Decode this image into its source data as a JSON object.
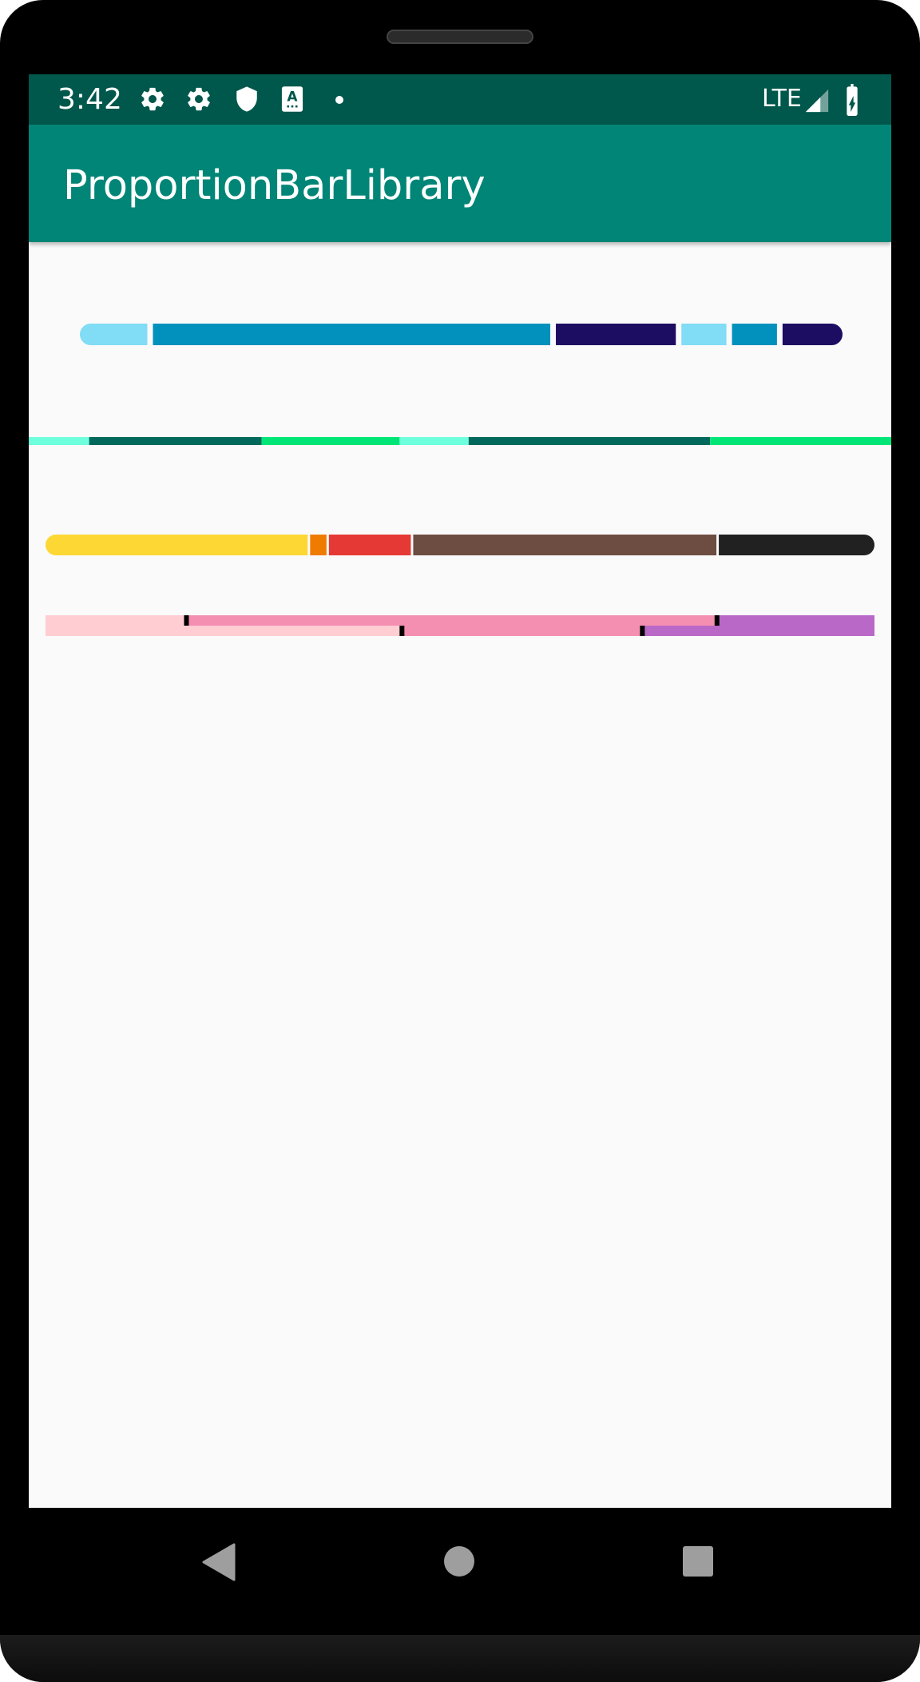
{
  "status_bar": {
    "time": "3:42",
    "network": "LTE",
    "icons": [
      "gear-icon",
      "gear-icon",
      "shield-icon",
      "text-a-icon",
      "dot-icon",
      "signal-icon",
      "battery-charging-icon"
    ]
  },
  "app_bar": {
    "title": "ProportionBarLibrary"
  },
  "colors": {
    "status_bar": "#00574b",
    "app_bar": "#008577",
    "background": "#fafafa"
  },
  "proportion_bars": [
    {
      "style": "rounded-ends, gaps between segments",
      "segments": [
        {
          "value": 0.09,
          "color": "#81dcf5"
        },
        {
          "value": 0.53,
          "color": "#0191bc"
        },
        {
          "value": 0.16,
          "color": "#1c0d62"
        },
        {
          "value": 0.06,
          "color": "#81dcf5"
        },
        {
          "value": 0.06,
          "color": "#0191bc"
        },
        {
          "value": 0.08,
          "color": "#1c0d62"
        }
      ]
    },
    {
      "style": "thin, full width, no gaps",
      "segments": [
        {
          "value": 0.07,
          "color": "#6effdd"
        },
        {
          "value": 0.2,
          "color": "#00695c"
        },
        {
          "value": 0.16,
          "color": "#00e676"
        },
        {
          "value": 0.08,
          "color": "#6effdd"
        },
        {
          "value": 0.28,
          "color": "#00695c"
        },
        {
          "value": 0.21,
          "color": "#00e676"
        }
      ]
    },
    {
      "style": "rounded-ends, thin separators",
      "segments": [
        {
          "value": 0.32,
          "color": "#fdd835"
        },
        {
          "value": 0.02,
          "color": "#ef7c00"
        },
        {
          "value": 0.1,
          "color": "#e53935"
        },
        {
          "value": 0.37,
          "color": "#6d4c41"
        },
        {
          "value": 0.19,
          "color": "#212121"
        }
      ]
    },
    {
      "style": "square ends, staggered halves with black dividers",
      "top_segments": [
        {
          "value": 0.17,
          "color": "#ffcdd2"
        },
        {
          "value": 0.64,
          "color": "#f48fb1"
        },
        {
          "value": 0.19,
          "color": "#ba68c8"
        }
      ],
      "bottom_segments": [
        {
          "value": 0.43,
          "color": "#ffcdd2"
        },
        {
          "value": 0.29,
          "color": "#f48fb1"
        },
        {
          "value": 0.28,
          "color": "#ba68c8"
        }
      ],
      "divider_color": "#000000"
    }
  ],
  "nav_bar": {
    "buttons": [
      "back-icon",
      "home-icon",
      "recents-icon"
    ]
  }
}
